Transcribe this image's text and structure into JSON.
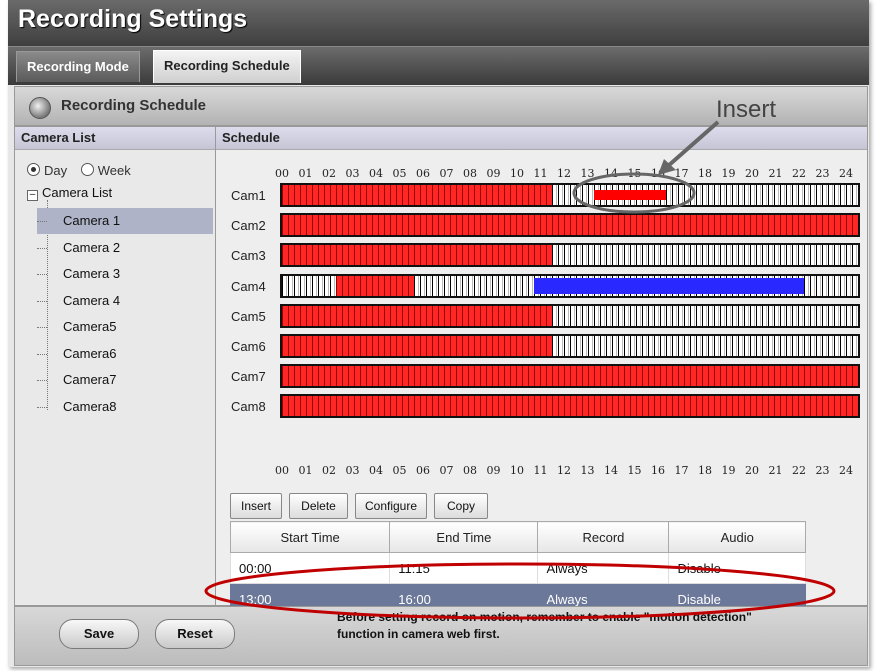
{
  "window": {
    "title": "Recording Settings"
  },
  "tabs": [
    {
      "label": "Recording Mode",
      "active": false
    },
    {
      "label": "Recording Schedule",
      "active": true
    }
  ],
  "section": {
    "title": "Recording Schedule",
    "icon": "camera-lens-icon"
  },
  "camera_list": {
    "header": "Camera List",
    "view_options": [
      {
        "label": "Day",
        "selected": true
      },
      {
        "label": "Week",
        "selected": false
      }
    ],
    "root_label": "Camera List",
    "cameras": [
      "Camera 1",
      "Camera 2",
      "Camera 3",
      "Camera 4",
      "Camera5",
      "Camera6",
      "Camera7",
      "Camera8"
    ],
    "selected_index": 0
  },
  "schedule": {
    "header": "Schedule",
    "hours": [
      "00",
      "01",
      "02",
      "03",
      "04",
      "05",
      "06",
      "07",
      "08",
      "09",
      "10",
      "11",
      "12",
      "13",
      "14",
      "15",
      "16",
      "17",
      "18",
      "19",
      "20",
      "21",
      "22",
      "23",
      "24"
    ],
    "rows": [
      {
        "label": "Cam1",
        "segments": [
          {
            "start": 0,
            "end": 11.25,
            "type": "always"
          },
          {
            "start": 13,
            "end": 16,
            "type": "selected"
          }
        ]
      },
      {
        "label": "Cam2",
        "segments": [
          {
            "start": 0,
            "end": 24,
            "type": "always"
          }
        ]
      },
      {
        "label": "Cam3",
        "segments": [
          {
            "start": 0,
            "end": 11.25,
            "type": "always"
          }
        ]
      },
      {
        "label": "Cam4",
        "segments": [
          {
            "start": 2.25,
            "end": 5.5,
            "type": "always"
          },
          {
            "start": 10.5,
            "end": 21.75,
            "type": "motion"
          }
        ]
      },
      {
        "label": "Cam5",
        "segments": [
          {
            "start": 0,
            "end": 11.25,
            "type": "always"
          }
        ]
      },
      {
        "label": "Cam6",
        "segments": [
          {
            "start": 0,
            "end": 11.25,
            "type": "always"
          }
        ]
      },
      {
        "label": "Cam7",
        "segments": [
          {
            "start": 0,
            "end": 24,
            "type": "always"
          }
        ]
      },
      {
        "label": "Cam8",
        "segments": [
          {
            "start": 0,
            "end": 24,
            "type": "always"
          }
        ]
      }
    ],
    "buttons": {
      "insert": "Insert",
      "delete": "Delete",
      "configure": "Configure",
      "copy": "Copy"
    },
    "table": {
      "columns": [
        "Start Time",
        "End Time",
        "Record",
        "Audio"
      ],
      "rows": [
        {
          "start": "00:00",
          "end": "11:15",
          "record": "Always",
          "audio": "Disable",
          "selected": false
        },
        {
          "start": "13:00",
          "end": "16:00",
          "record": "Always",
          "audio": "Disable",
          "selected": true
        }
      ]
    }
  },
  "footer": {
    "save": "Save",
    "reset": "Reset",
    "note_line1": "Before setting record on motion, remember to enable \"motion detection\"",
    "note_line2": "function in camera web first."
  },
  "annotation": {
    "label": "Insert"
  },
  "colors": {
    "always": "#ff2626",
    "motion": "#2929ff",
    "selected_row": "#6b7899",
    "annotation_ellipse": "#c00000"
  }
}
